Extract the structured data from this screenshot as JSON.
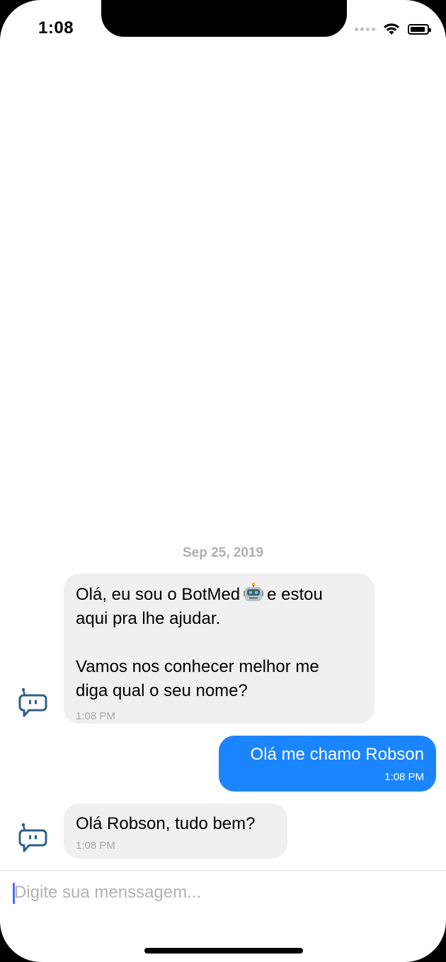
{
  "status_bar": {
    "time": "1:08"
  },
  "chat": {
    "date_separator": "Sep 25, 2019",
    "messages": [
      {
        "side": "incoming",
        "line1_before_emoji": "Olá, eu sou o BotMed",
        "emoji": "robot-face",
        "line1_after_emoji": "e estou",
        "rest": "aqui pra lhe ajudar.\n\nVamos nos conhecer melhor me\ndiga qual o seu nome?",
        "time": "1:08 PM"
      },
      {
        "side": "outgoing",
        "text": "Olá me chamo Robson",
        "time": "1:08 PM"
      },
      {
        "side": "incoming",
        "text": "Olá Robson, tudo bem?",
        "time": "1:08 PM"
      }
    ]
  },
  "composer": {
    "placeholder": "Digite sua menssagem...",
    "value": ""
  },
  "icons": {
    "bot_avatar": "chatbot-icon",
    "accent": "#1a85ff",
    "bot_icon_color": "#2e5f86"
  }
}
